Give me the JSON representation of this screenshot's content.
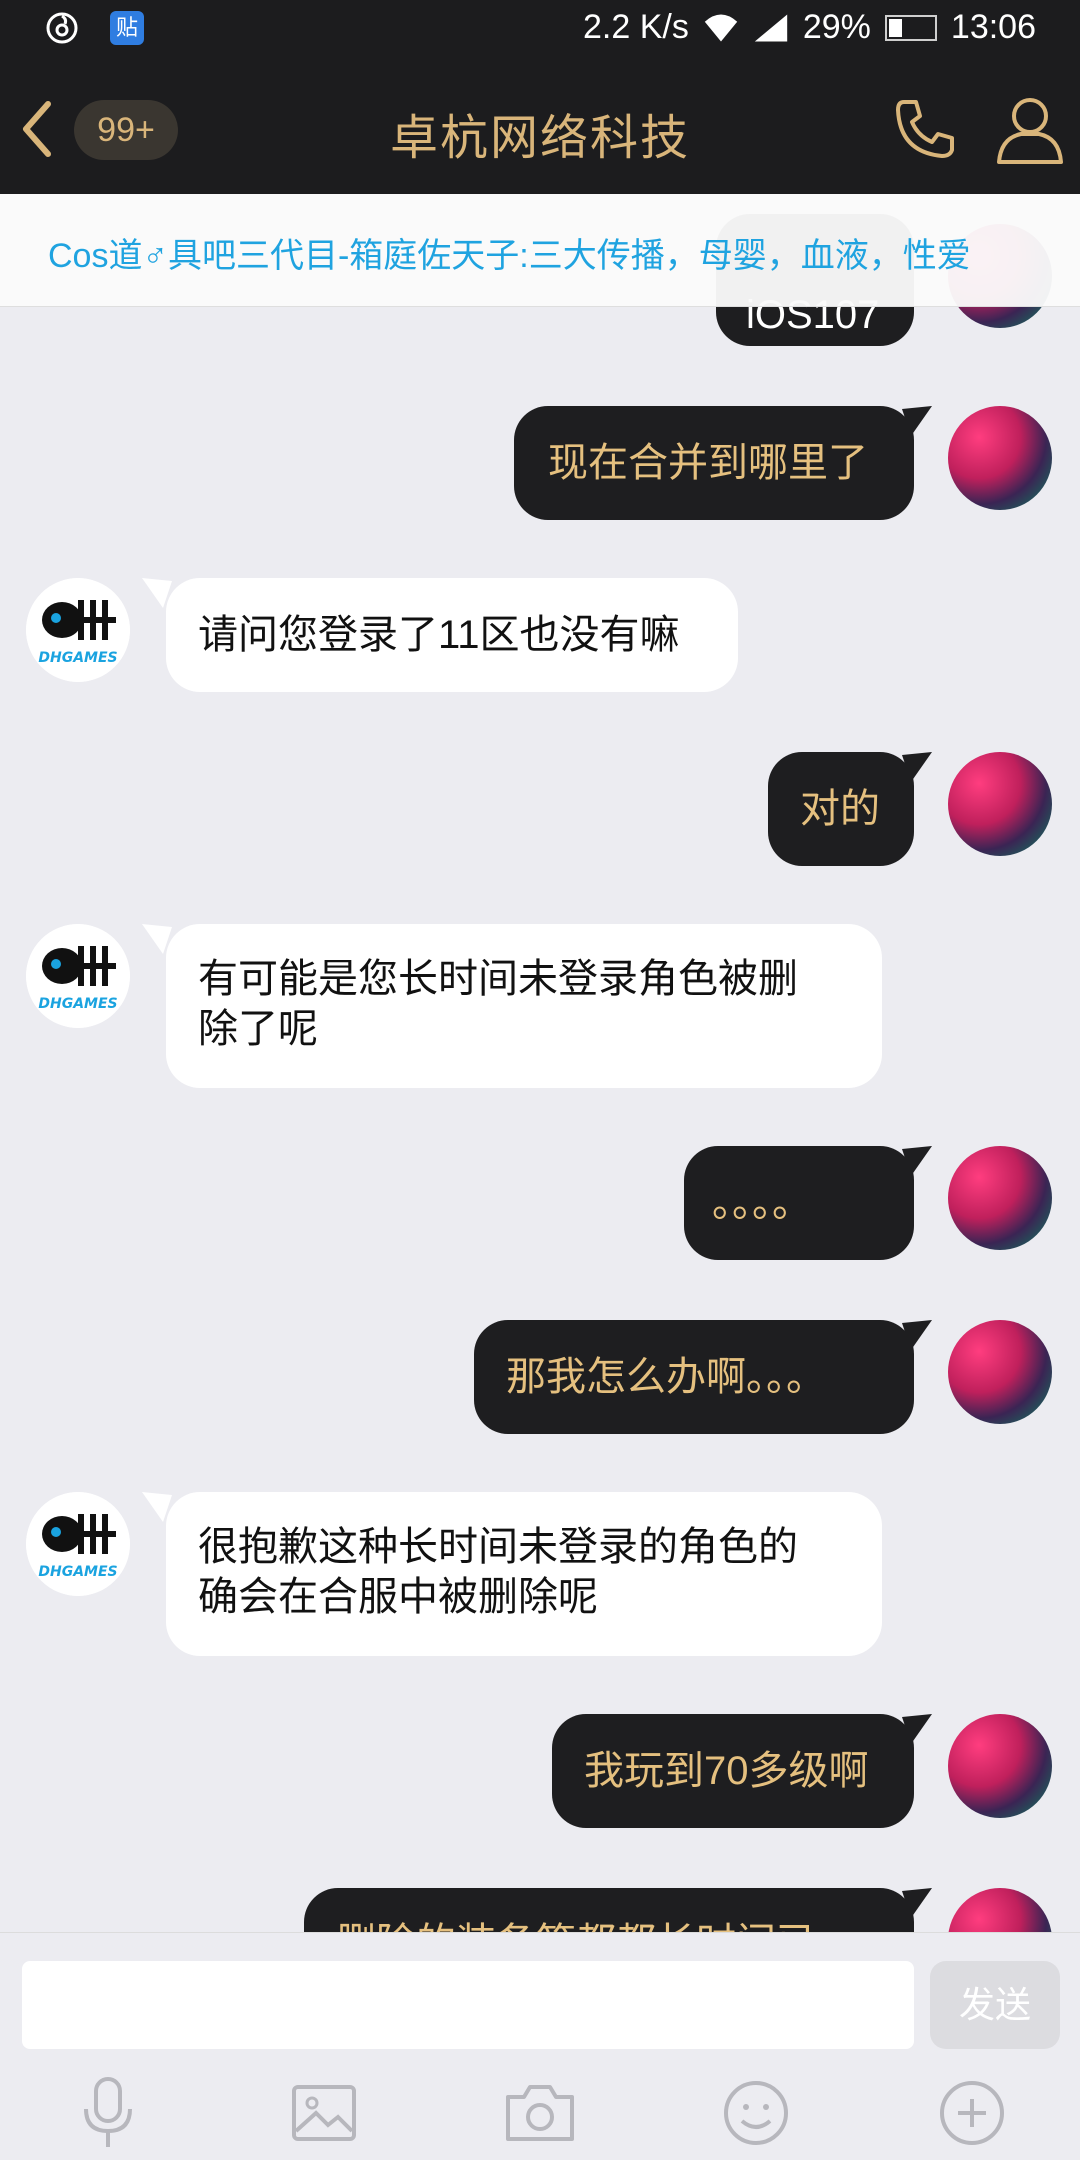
{
  "status_bar": {
    "network_speed": "2.2 K/s",
    "battery": "29%",
    "battery_level": 0.29,
    "time": "13:06",
    "icons": [
      "netease-music-icon",
      "tieba-icon",
      "wifi-icon",
      "signal-icon",
      "battery-icon"
    ],
    "tieba_char": "贴"
  },
  "header": {
    "unread_badge": "99+",
    "title": "卓杭网络科技",
    "accent_color": "#d9b57a"
  },
  "notice": {
    "text": "Cos道♂具吧三代目-箱庭佐天子:三大传播，母婴，血液，性爱"
  },
  "messages": [
    {
      "side": "out",
      "text": "iOS107",
      "partial": true
    },
    {
      "side": "out",
      "text": "现在合并到哪里了"
    },
    {
      "side": "in",
      "text": "请问您登录了11区也没有嘛"
    },
    {
      "side": "out",
      "text": "对的"
    },
    {
      "side": "in",
      "line1": "有可能是您长时间未登录角色被删",
      "line2": "除了呢"
    },
    {
      "side": "out",
      "text": "。。。。"
    },
    {
      "side": "out",
      "text": "那我怎么办啊。。。"
    },
    {
      "side": "in",
      "line1": "很抱歉这种长时间未登录的角色的",
      "line2": "确会在合服中被删除呢"
    },
    {
      "side": "out",
      "text": "我玩到70多级啊"
    },
    {
      "side": "out",
      "text": "删除的装备等都都长时间已",
      "partial": true
    }
  ],
  "service_avatar": {
    "logo_text": "DHGAMES"
  },
  "input": {
    "value": "",
    "send_label": "发送"
  },
  "toolbar": [
    "microphone-icon",
    "image-icon",
    "camera-icon",
    "emoji-icon",
    "plus-icon"
  ]
}
